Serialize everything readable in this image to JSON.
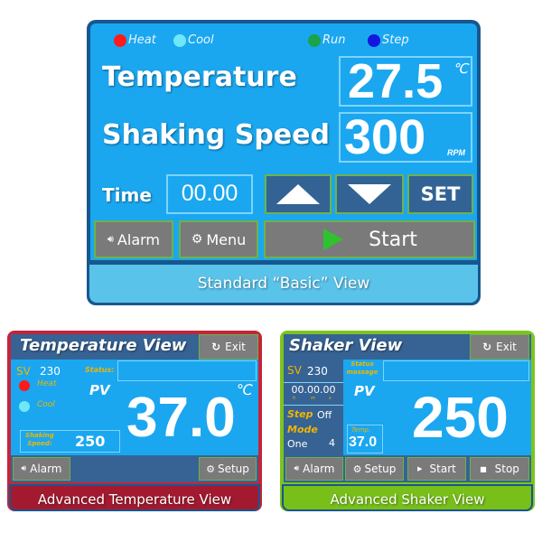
{
  "standard_view": {
    "indicators": [
      {
        "label": "Heat",
        "color": "#ff1a1a"
      },
      {
        "label": "Cool",
        "color": "#6fe7f5"
      },
      {
        "label": "Run",
        "color": "#1aa34a"
      },
      {
        "label": "Step",
        "color": "#1515e0"
      }
    ],
    "temperature_label": "Temperature",
    "temperature_value": "27.5",
    "temperature_unit": "℃",
    "speed_label": "Shaking Speed",
    "speed_value": "300",
    "speed_unit": "RPM",
    "time_label": "Time",
    "time_value": "00.00",
    "up_button": "up-arrow",
    "down_button": "down-arrow",
    "set_label": "SET",
    "alarm_label": "Alarm",
    "menu_label": "Menu",
    "start_label": "Start",
    "caption": "Standard “Basic” View"
  },
  "temperature_view": {
    "title": "Temperature  View",
    "exit_label": "Exit",
    "sv_label": "SV",
    "sv_value": "230",
    "status_label": "Status:",
    "status_value": "",
    "heat_label": "Heat",
    "cool_label": "Cool",
    "pv_label": "PV",
    "pv_value": "37.0",
    "unit": "℃",
    "shaking_label_1": "Shaking",
    "shaking_label_2": "Speed:",
    "shaking_value": "250",
    "alarm_label": "Alarm",
    "setup_label": "Setup",
    "caption": "Advanced Temperature View",
    "colors": {
      "frame": "#c4243a",
      "caption_bg": "#a31a30",
      "heat": "#ff1a1a",
      "cool": "#6fe7f5"
    }
  },
  "shaker_view": {
    "title": "Shaker View",
    "exit_label": "Exit",
    "sv_label": "SV",
    "sv_value": "230",
    "status_label_1": "Status",
    "status_label_2": "massage",
    "status_value": "",
    "time_value": "00.00.00",
    "time_units": [
      "h",
      "m",
      "s"
    ],
    "pv_label": "PV",
    "pv_value": "250",
    "step_label": "Step",
    "step_value": "Off",
    "mode_label": "Mode",
    "mode_value": "One",
    "mode_number": "4",
    "temp_label": "Temp.",
    "temp_value": "37.0",
    "alarm_label": "Alarm",
    "setup_label": "Setup",
    "start_label": "Start",
    "stop_label": "Stop",
    "caption": "Advanced Shaker View",
    "colors": {
      "frame": "#7cc41c",
      "caption_bg": "#78bf1a"
    }
  }
}
